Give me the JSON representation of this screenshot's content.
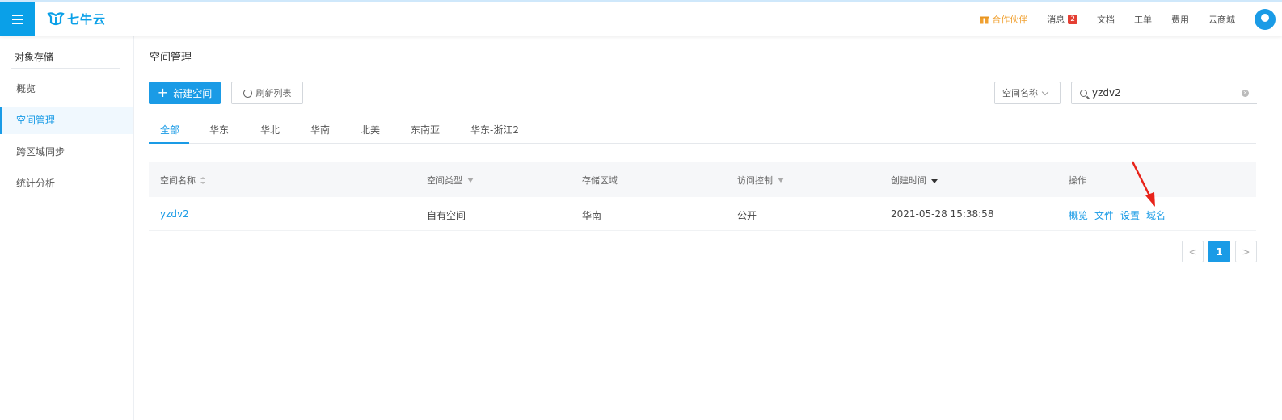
{
  "header": {
    "logo_text": "七牛云",
    "nav": [
      {
        "label": "合作伙伴",
        "icon": "gift-icon"
      },
      {
        "label": "消息",
        "badge": "2"
      },
      {
        "label": "文档"
      },
      {
        "label": "工单"
      },
      {
        "label": "费用"
      },
      {
        "label": "云商城"
      }
    ]
  },
  "sidebar": {
    "title": "对象存储",
    "items": [
      {
        "label": "概览"
      },
      {
        "label": "空间管理",
        "active": true
      },
      {
        "label": "跨区域同步"
      },
      {
        "label": "统计分析"
      }
    ]
  },
  "main": {
    "title": "空间管理",
    "new_button": "新建空间",
    "refresh_button": "刷新列表",
    "search_field_select": "空间名称",
    "search_value": "yzdv2",
    "tabs": [
      "全部",
      "华东",
      "华北",
      "华南",
      "北美",
      "东南亚",
      "华东-浙江2"
    ],
    "active_tab": "全部",
    "table": {
      "columns": [
        "空间名称",
        "空间类型",
        "存储区域",
        "访问控制",
        "创建时间",
        "操作"
      ],
      "rows": [
        {
          "name": "yzdv2",
          "type": "自有空间",
          "region": "华南",
          "access": "公开",
          "created": "2021-05-28 15:38:58",
          "actions": [
            "概览",
            "文件",
            "设置",
            "域名"
          ]
        }
      ]
    },
    "pagination": {
      "prev": "<",
      "current": "1",
      "next": ">"
    }
  },
  "colors": {
    "primary": "#1a9be6",
    "partner": "#f0a030",
    "badge": "#e43f33",
    "annotation_arrow": "#e8231a"
  }
}
